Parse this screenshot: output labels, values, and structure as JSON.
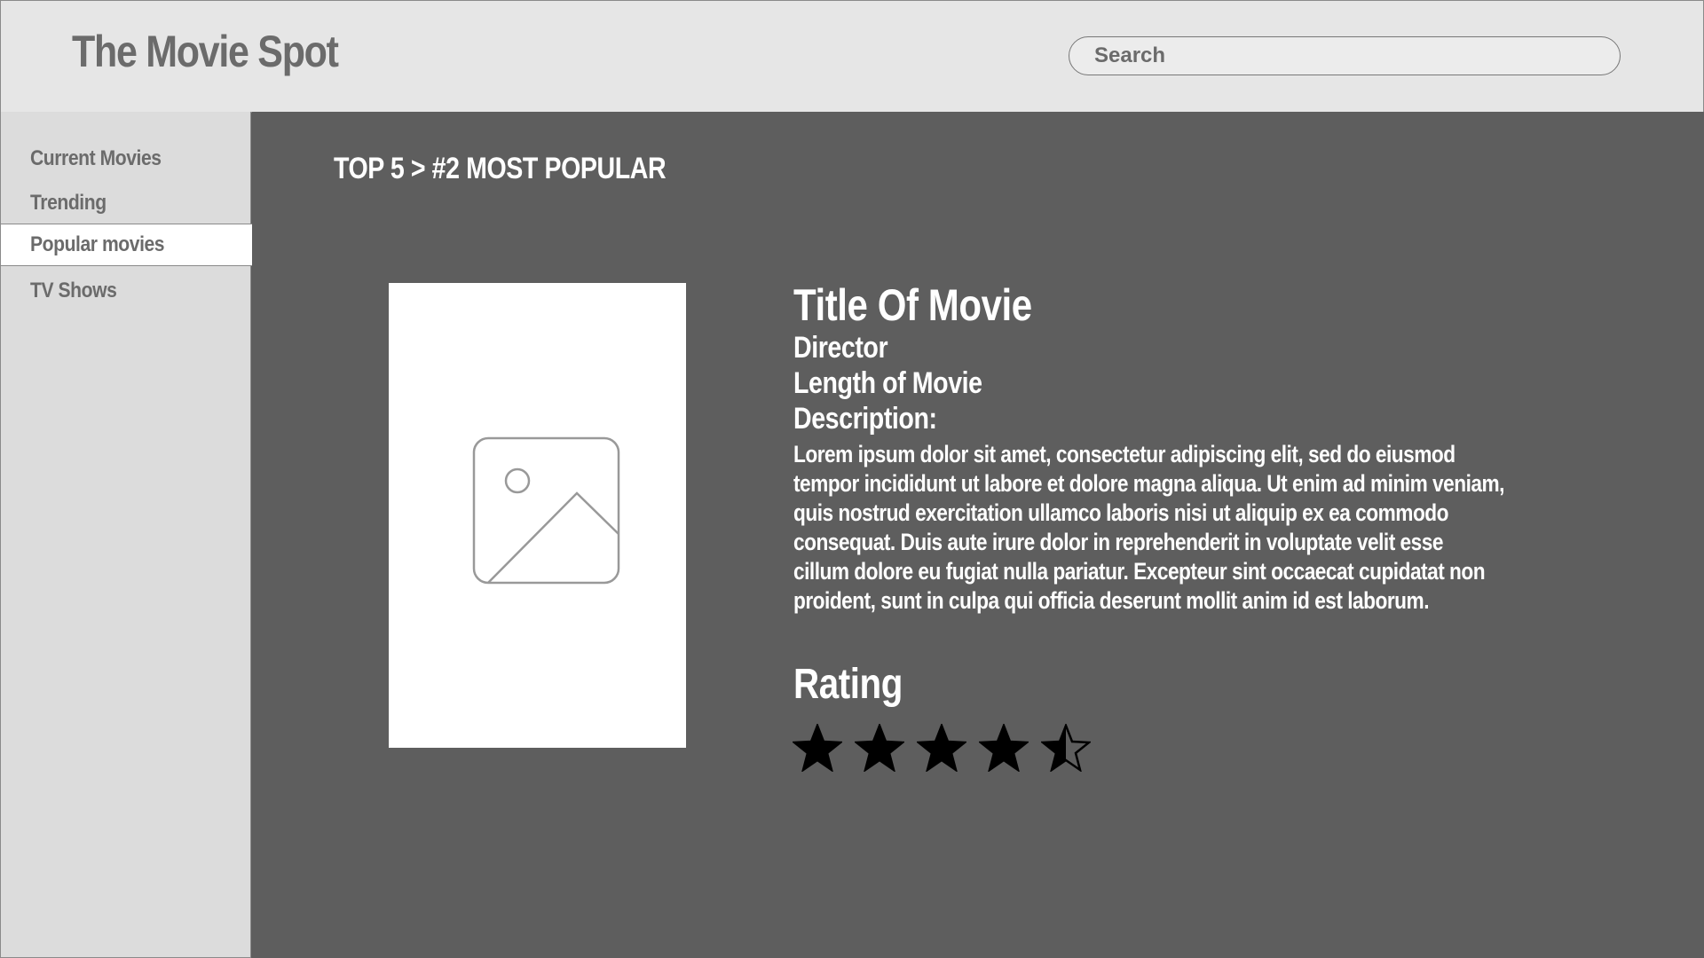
{
  "header": {
    "app_title": "The Movie Spot",
    "search_placeholder": "Search"
  },
  "sidebar": {
    "items": [
      {
        "label": "Current Movies",
        "active": false
      },
      {
        "label": "Trending",
        "active": false
      },
      {
        "label": "Popular movies",
        "active": true
      },
      {
        "label": "TV Shows",
        "active": false
      }
    ]
  },
  "main": {
    "breadcrumb": "TOP 5 > #2 MOST POPULAR",
    "poster_icon": "image-placeholder-icon",
    "movie": {
      "title": "Title Of Movie",
      "director": "Director",
      "length": "Length of Movie",
      "description_label": "Description:",
      "description": "Lorem ipsum dolor sit amet, consectetur adipiscing elit, sed do eiusmod\n tempor incididunt ut labore et dolore magna aliqua. Ut enim ad minim veniam,\nquis nostrud exercitation ullamco laboris nisi ut aliquip ex ea commodo\n consequat. Duis aute irure dolor in reprehenderit in voluptate velit esse\ncillum dolore eu fugiat nulla pariatur. Excepteur sint occaecat cupidatat non\n proident, sunt in culpa qui officia deserunt mollit anim id est laborum."
    },
    "rating": {
      "label": "Rating",
      "value": 4.5,
      "max": 5
    }
  },
  "colors": {
    "header_bg": "#e6e6e6",
    "sidebar_bg": "#dcdcdc",
    "main_bg": "#5e5e5e",
    "muted_text": "#6b6b6b",
    "star": "#000000"
  }
}
